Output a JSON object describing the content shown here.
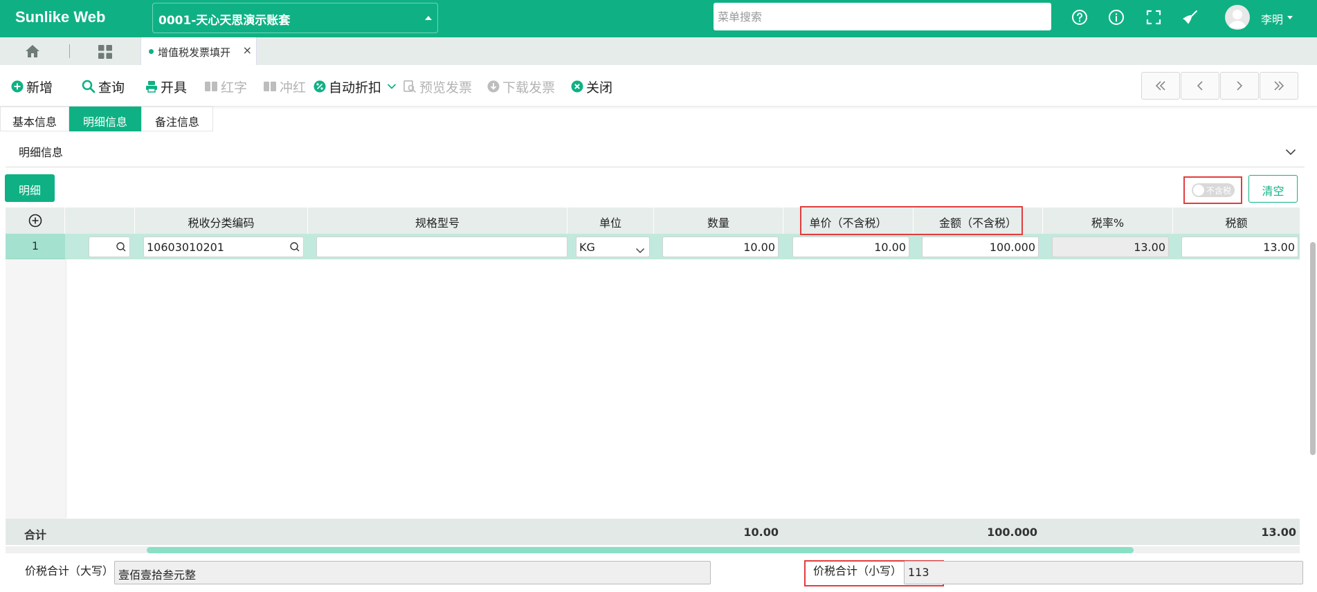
{
  "app": {
    "title": "Sunlike Web",
    "account": "0001-天心天思演示账套",
    "search_placeholder": "菜单搜索",
    "username": "李明"
  },
  "topbar_icons": [
    "help-icon",
    "info-icon",
    "fullscreen-icon",
    "broom-icon",
    "user-avatar-icon"
  ],
  "tabs": {
    "active": "增值税发票填开"
  },
  "toolbar": {
    "new": "新增",
    "query": "查询",
    "issue": "开具",
    "red": "红字",
    "reverse": "冲红",
    "auto_discount": "自动折扣",
    "preview": "预览发票",
    "download": "下载发票",
    "close": "关闭"
  },
  "subtabs": [
    "基本信息",
    "明细信息",
    "备注信息"
  ],
  "section": {
    "title": "明细信息"
  },
  "detail_button": "明细",
  "toggle_label": "不含税",
  "clear_button": "清空",
  "grid": {
    "columns": [
      "税收分类编码",
      "规格型号",
      "单位",
      "数量",
      "单价（不含税）",
      "金额（不含税）",
      "税率%",
      "税额"
    ],
    "rows": [
      {
        "no": "1",
        "tax_code": "10603010201",
        "spec": "",
        "unit": "KG",
        "qty": "10.00",
        "price": "10.00",
        "amount": "100.000",
        "rate": "13.00",
        "tax": "13.00"
      }
    ],
    "footer": {
      "label": "合计",
      "qty": "10.00",
      "amount": "100.000",
      "tax": "13.00"
    }
  },
  "totals": {
    "upper_label": "价税合计（大写）",
    "upper_value": "壹佰壹拾叁元整",
    "lower_label": "价税合计（小写）",
    "lower_value": "113"
  },
  "colors": {
    "primary": "#0fb184",
    "highlight_row": "#c2e9dd",
    "annotation": "#e23c3c"
  }
}
